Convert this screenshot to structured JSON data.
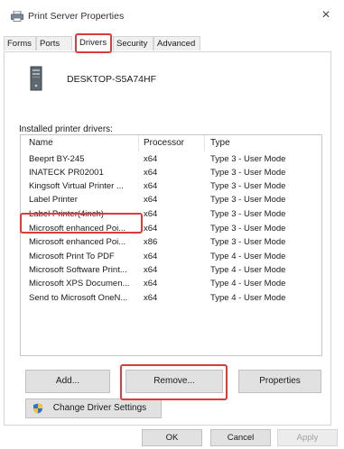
{
  "window": {
    "title": "Print Server Properties",
    "close_glyph": "×"
  },
  "tabs": [
    {
      "label": "Forms",
      "active": false
    },
    {
      "label": "Ports",
      "active": false
    },
    {
      "label": "Drivers",
      "active": true
    },
    {
      "label": "Security",
      "active": false
    },
    {
      "label": "Advanced",
      "active": false
    }
  ],
  "server": {
    "name": "DESKTOP-S5A74HF",
    "icon": "computer-tower-icon"
  },
  "drivers": {
    "section_label": "Installed printer drivers:",
    "columns": [
      "Name",
      "Processor",
      "Type"
    ],
    "rows": [
      {
        "name": "Beeprt BY-245",
        "processor": "x64",
        "type": "Type 3 - User Mode"
      },
      {
        "name": "INATECK PR02001",
        "processor": "x64",
        "type": "Type 3 - User Mode"
      },
      {
        "name": "Kingsoft Virtual Printer ...",
        "processor": "x64",
        "type": "Type 3 - User Mode"
      },
      {
        "name": "Label Printer",
        "processor": "x64",
        "type": "Type 3 - User Mode"
      },
      {
        "name": "Label Printer(4inch)",
        "processor": "x64",
        "type": "Type 3 - User Mode"
      },
      {
        "name": "Microsoft enhanced Poi...",
        "processor": "x64",
        "type": "Type 3 - User Mode"
      },
      {
        "name": "Microsoft enhanced Poi...",
        "processor": "x86",
        "type": "Type 3 - User Mode"
      },
      {
        "name": "Microsoft Print To PDF",
        "processor": "x64",
        "type": "Type 4 - User Mode"
      },
      {
        "name": "Microsoft Software Print...",
        "processor": "x64",
        "type": "Type 4 - User Mode"
      },
      {
        "name": "Microsoft XPS Documen...",
        "processor": "x64",
        "type": "Type 4 - User Mode"
      },
      {
        "name": "Send to Microsoft OneN...",
        "processor": "x64",
        "type": "Type 4 - User Mode"
      }
    ]
  },
  "buttons": {
    "add": "Add...",
    "remove": "Remove...",
    "properties": "Properties",
    "change_driver": "Change Driver Settings",
    "ok": "OK",
    "cancel": "Cancel",
    "apply": "Apply"
  },
  "colors": {
    "highlight": "#e13a3a",
    "button_face": "#e1e1e1",
    "shield_blue": "#2f6fd6",
    "shield_yellow": "#f2c531"
  }
}
